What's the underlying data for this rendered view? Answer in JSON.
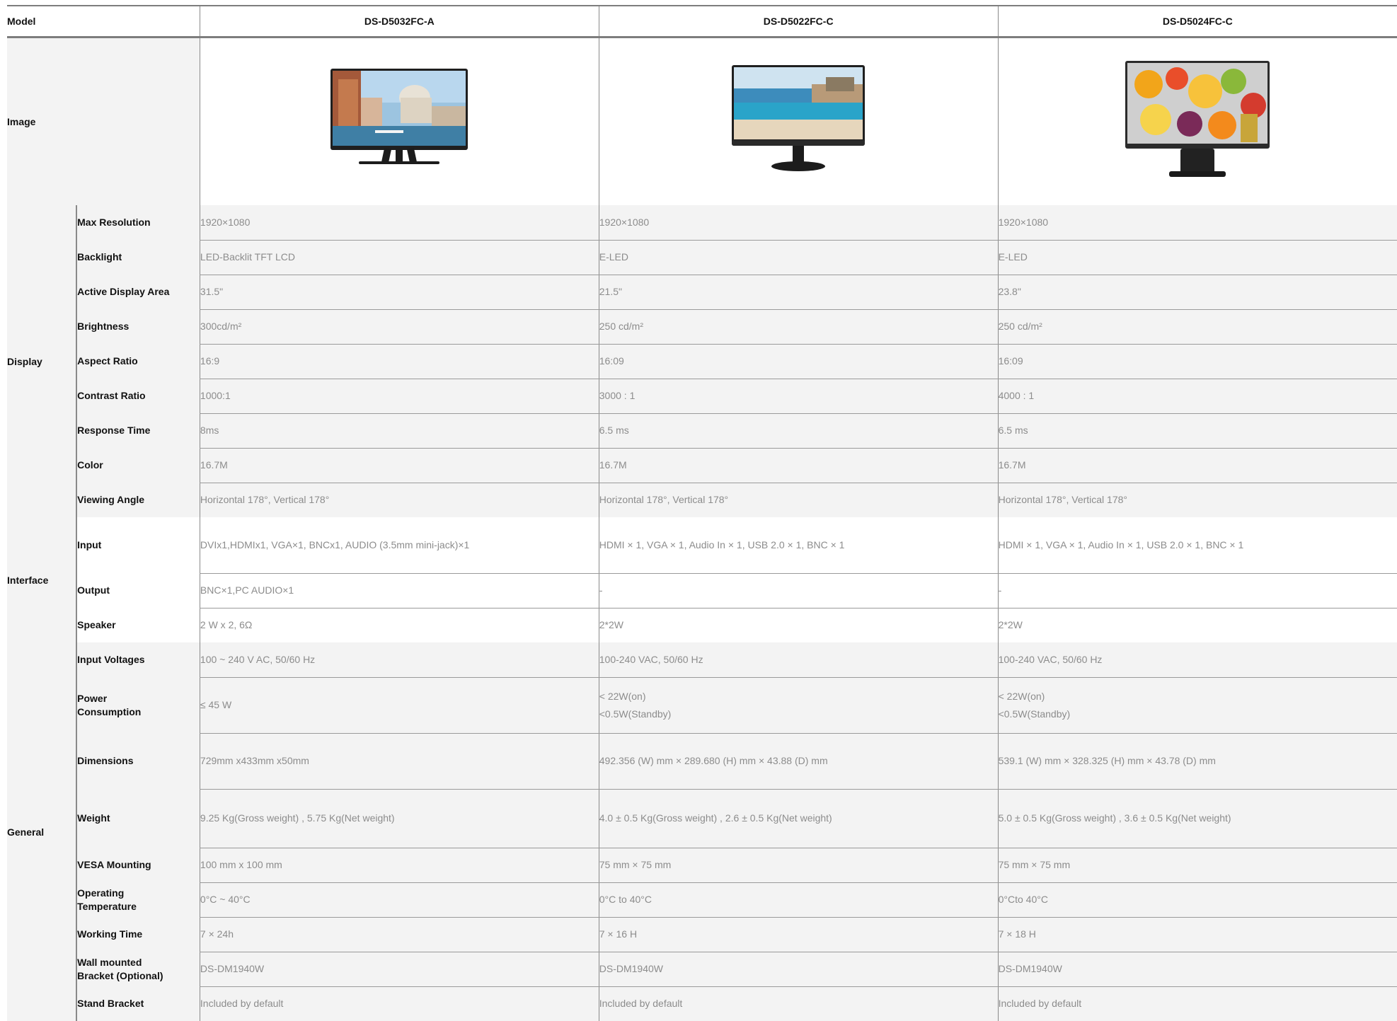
{
  "header": {
    "model_label": "Model",
    "models": [
      "DS-D5032FC-A",
      "DS-D5022FC-C",
      "DS-D5024FC-C"
    ]
  },
  "image_row": {
    "label": "Image"
  },
  "groups": {
    "display": "Display",
    "interface": "Interface",
    "general": "General"
  },
  "rows": {
    "max_resolution": {
      "label": "Max Resolution",
      "values": [
        "1920×1080",
        "1920×1080",
        "1920×1080"
      ]
    },
    "backlight": {
      "label": "Backlight",
      "values": [
        "LED-Backlit TFT LCD",
        "E-LED",
        "E-LED"
      ]
    },
    "active_display_area": {
      "label": "Active Display Area",
      "values": [
        "31.5\"",
        "21.5\"",
        "23.8\""
      ]
    },
    "brightness": {
      "label": "Brightness",
      "values": [
        "300cd/m²",
        "250 cd/m²",
        "250 cd/m²"
      ]
    },
    "aspect_ratio": {
      "label": "Aspect Ratio",
      "values": [
        "16:9",
        "16:09",
        "16:09"
      ]
    },
    "contrast_ratio": {
      "label": "Contrast Ratio",
      "values": [
        "1000:1",
        "3000 : 1",
        "4000 : 1"
      ]
    },
    "response_time": {
      "label": "Response Time",
      "values": [
        "8ms",
        "6.5 ms",
        "6.5 ms"
      ]
    },
    "color": {
      "label": "Color",
      "values": [
        "16.7M",
        "16.7M",
        "16.7M"
      ]
    },
    "viewing_angle": {
      "label": "Viewing Angle",
      "values": [
        "Horizontal 178°, Vertical 178°",
        "Horizontal 178°, Vertical 178°",
        "Horizontal 178°, Vertical 178°"
      ]
    },
    "input": {
      "label": "Input",
      "values": [
        "DVIx1,HDMIx1, VGA×1, BNCx1, AUDIO (3.5mm mini-jack)×1",
        "HDMI × 1, VGA × 1, Audio In × 1, USB 2.0 × 1, BNC × 1",
        "HDMI × 1, VGA × 1, Audio In × 1, USB 2.0 × 1, BNC × 1"
      ]
    },
    "output": {
      "label": "Output",
      "values": [
        "BNC×1,PC AUDIO×1",
        "-",
        "-"
      ]
    },
    "speaker": {
      "label": "Speaker",
      "values": [
        "2 W x 2, 6Ω",
        "2*2W",
        "2*2W"
      ]
    },
    "input_voltages": {
      "label": "Input Voltages",
      "values": [
        "100 ~ 240 V AC, 50/60 Hz",
        "100-240 VAC, 50/60 Hz",
        "100-240 VAC, 50/60 Hz"
      ]
    },
    "power_consumption": {
      "label_line1": "Power",
      "label_line2": "Consumption",
      "values": [
        {
          "line1": "≤ 45 W",
          "line2": ""
        },
        {
          "line1": "< 22W(on)",
          "line2": "<0.5W(Standby)"
        },
        {
          "line1": "< 22W(on)",
          "line2": "<0.5W(Standby)"
        }
      ]
    },
    "dimensions": {
      "label": "Dimensions",
      "values": [
        "729mm x433mm x50mm",
        "492.356 (W) mm × 289.680 (H) mm × 43.88 (D) mm",
        "539.1 (W) mm × 328.325 (H) mm × 43.78 (D) mm"
      ]
    },
    "weight": {
      "label": "Weight",
      "values": [
        "9.25 Kg(Gross weight) , 5.75 Kg(Net weight)",
        "4.0 ± 0.5 Kg(Gross weight) , 2.6 ± 0.5 Kg(Net weight)",
        "5.0 ± 0.5 Kg(Gross weight) ,  3.6 ± 0.5 Kg(Net weight)"
      ]
    },
    "vesa_mounting": {
      "label": "VESA Mounting",
      "values": [
        "100 mm x 100 mm",
        "75 mm × 75 mm",
        "75 mm × 75 mm"
      ]
    },
    "operating_temperature": {
      "label_line1": "Operating",
      "label_line2": "Temperature",
      "values": [
        "0°C ~ 40°C",
        "0°C to 40°C",
        "0°Cto 40°C"
      ]
    },
    "working_time": {
      "label": "Working Time",
      "values": [
        "7 × 24h",
        "7 × 16 H",
        "7 × 18 H"
      ]
    },
    "wall_bracket": {
      "label_line1": "Wall mounted",
      "label_line2": "Bracket (Optional)",
      "values": [
        "DS-DM1940W",
        "DS-DM1940W",
        "DS-DM1940W"
      ]
    },
    "stand_bracket": {
      "label": "Stand Bracket",
      "values": [
        "Included by default",
        "Included by default",
        "Included by default"
      ]
    }
  },
  "colors": {
    "row_grey": "#f3f3f3",
    "rule": "#8a8a8a",
    "value_text": "#8c8c8c",
    "label_text": "#111111"
  }
}
